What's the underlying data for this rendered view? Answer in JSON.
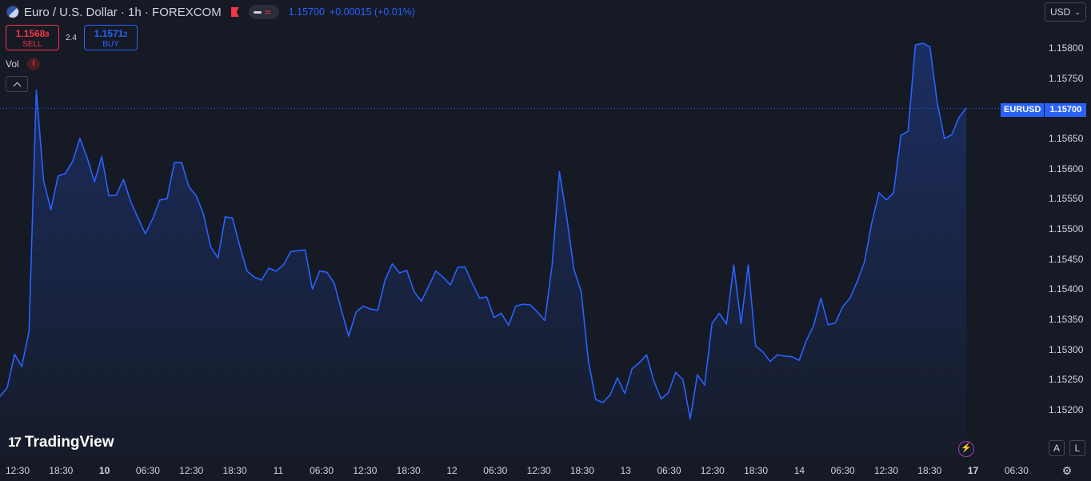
{
  "header": {
    "symbol": "Euro / U.S. Dollar · 1h · FOREXCOM",
    "price": "1.15700",
    "change": "+0.00015 (+0.01%)"
  },
  "currency": {
    "label": "USD"
  },
  "trade": {
    "sell_price_main": "1.1568",
    "sell_price_pip": "8",
    "sell_label": "SELL",
    "spread": "2.4",
    "buy_price_main": "1.1571",
    "buy_price_pip": "2",
    "buy_label": "BUY"
  },
  "volume": {
    "label": "Vol",
    "warning": "!"
  },
  "price_tag": {
    "symbol": "EURUSD",
    "price": "1.15700"
  },
  "logo": {
    "text": "TradingView",
    "mark": "17"
  },
  "bottom_controls": {
    "auto": "A",
    "log": "L"
  },
  "colors": {
    "line": "#2962ff",
    "sell": "#f23645",
    "buy": "#2962ff",
    "background": "#161a25"
  },
  "chart_data": {
    "type": "area",
    "y_tick_labels": [
      "1.15800",
      "1.15750",
      "1.15650",
      "1.15600",
      "1.15550",
      "1.15500",
      "1.15450",
      "1.15400",
      "1.15350",
      "1.15300",
      "1.15250",
      "1.15200"
    ],
    "x_tick_labels": [
      {
        "label": "12:30",
        "bold": false
      },
      {
        "label": "18:30",
        "bold": false
      },
      {
        "label": "10",
        "bold": true
      },
      {
        "label": "06:30",
        "bold": false
      },
      {
        "label": "12:30",
        "bold": false
      },
      {
        "label": "18:30",
        "bold": false
      },
      {
        "label": "11",
        "bold": false
      },
      {
        "label": "06:30",
        "bold": false
      },
      {
        "label": "12:30",
        "bold": false
      },
      {
        "label": "18:30",
        "bold": false
      },
      {
        "label": "12",
        "bold": false
      },
      {
        "label": "06:30",
        "bold": false
      },
      {
        "label": "12:30",
        "bold": false
      },
      {
        "label": "18:30",
        "bold": false
      },
      {
        "label": "13",
        "bold": false
      },
      {
        "label": "06:30",
        "bold": false
      },
      {
        "label": "12:30",
        "bold": false
      },
      {
        "label": "18:30",
        "bold": false
      },
      {
        "label": "14",
        "bold": false
      },
      {
        "label": "06:30",
        "bold": false
      },
      {
        "label": "12:30",
        "bold": false
      },
      {
        "label": "18:30",
        "bold": false
      },
      {
        "label": "17",
        "bold": true
      },
      {
        "label": "06:30",
        "bold": false
      }
    ],
    "ylim": [
      1.1517,
      1.1582
    ],
    "last_price": 1.157,
    "series": [
      {
        "values": [
          1.15222,
          1.15237,
          1.15292,
          1.15272,
          1.1533,
          1.1573,
          1.1558,
          1.15532,
          1.15588,
          1.15592,
          1.15612,
          1.1565,
          1.15618,
          1.15578,
          1.1562,
          1.15555,
          1.15556,
          1.15582,
          1.15545,
          1.15518,
          1.15492,
          1.15516,
          1.15548,
          1.1555,
          1.1561,
          1.1561,
          1.1557,
          1.15555,
          1.15525,
          1.1547,
          1.15452,
          1.1552,
          1.15518,
          1.15472,
          1.1543,
          1.1542,
          1.15415,
          1.15435,
          1.1543,
          1.1544,
          1.15462,
          1.15464,
          1.15465,
          1.154,
          1.1543,
          1.15428,
          1.1541,
          1.15365,
          1.15322,
          1.15362,
          1.15372,
          1.15367,
          1.15365,
          1.15415,
          1.15442,
          1.15427,
          1.15431,
          1.15396,
          1.1538,
          1.15405,
          1.1543,
          1.1542,
          1.15407,
          1.15436,
          1.15437,
          1.1541,
          1.15385,
          1.15387,
          1.15353,
          1.1536,
          1.1534,
          1.15372,
          1.15375,
          1.15374,
          1.15362,
          1.15348,
          1.1544,
          1.15595,
          1.1552,
          1.15433,
          1.15396,
          1.1528,
          1.15217,
          1.15212,
          1.15225,
          1.15253,
          1.15227,
          1.15268,
          1.15278,
          1.15291,
          1.15248,
          1.15218,
          1.15228,
          1.15262,
          1.1525,
          1.15185,
          1.15258,
          1.15241,
          1.15343,
          1.1536,
          1.15342,
          1.1544,
          1.15343,
          1.1544,
          1.15306,
          1.15296,
          1.1528,
          1.15291,
          1.15289,
          1.15288,
          1.15282,
          1.15315,
          1.1534,
          1.15385,
          1.15341,
          1.15344,
          1.15371,
          1.15385,
          1.15413,
          1.15445,
          1.1551,
          1.1556,
          1.15548,
          1.1556,
          1.15655,
          1.15662,
          1.15805,
          1.15808,
          1.15802,
          1.1571,
          1.1565,
          1.15656,
          1.15685,
          1.157
        ]
      }
    ]
  }
}
